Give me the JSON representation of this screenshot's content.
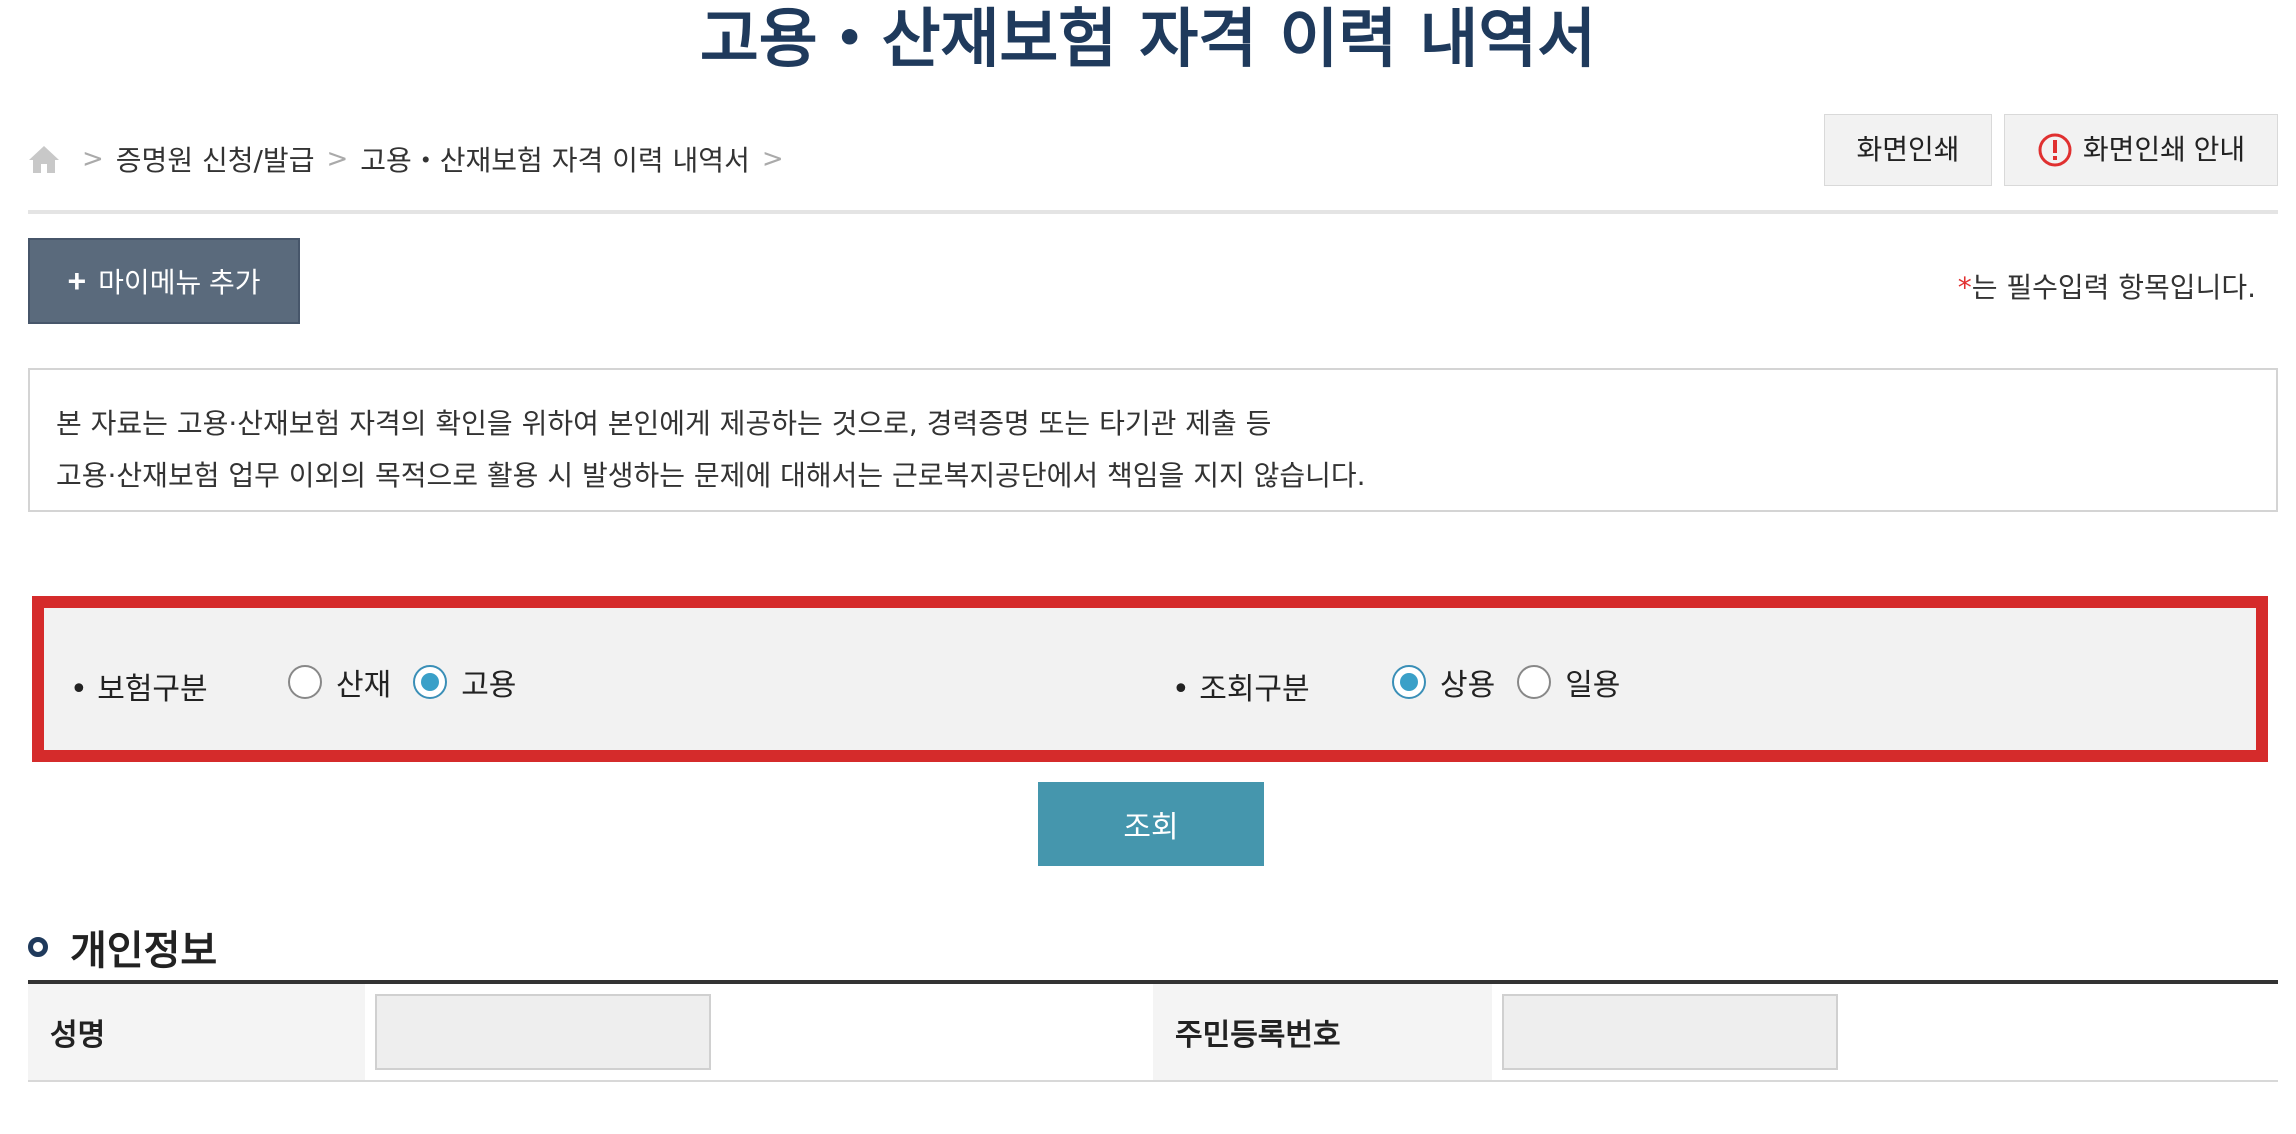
{
  "page": {
    "title": "고용・산재보험 자격 이력 내역서"
  },
  "breadcrumb": {
    "home_icon": "home-icon",
    "items": [
      "증명원 신청/발급",
      "고용・산재보험 자격 이력 내역서"
    ],
    "separator": ">"
  },
  "header_buttons": {
    "print_label": "화면인쇄",
    "print_guide_label": "화면인쇄 안내",
    "print_guide_icon": "warning-circle-icon"
  },
  "toolbar": {
    "add_mymenu_label": "마이메뉴 추가",
    "required_star": "*",
    "required_note": "는 필수입력 항목입니다."
  },
  "notice": {
    "line1": "본 자료는 고용·산재보험 자격의 확인을 위하여 본인에게 제공하는 것으로, 경력증명 또는 타기관 제출 등",
    "line2": "고용·산재보험 업무 이외의 목적으로 활용 시 발생하는 문제에 대해서는 근로복지공단에서 책임을 지지 않습니다."
  },
  "search": {
    "insurance_type": {
      "label": "• 보험구분",
      "options": [
        "산재",
        "고용"
      ],
      "selected": "고용"
    },
    "query_type": {
      "label": "• 조회구분",
      "options": [
        "상용",
        "일용"
      ],
      "selected": "상용"
    },
    "highlight_color": "#d52b2b"
  },
  "query_button": {
    "label": "조회",
    "color": "#4596ad"
  },
  "personal_info": {
    "section_title": "개인정보",
    "name_label": "성명",
    "rrn_label": "주민등록번호"
  }
}
